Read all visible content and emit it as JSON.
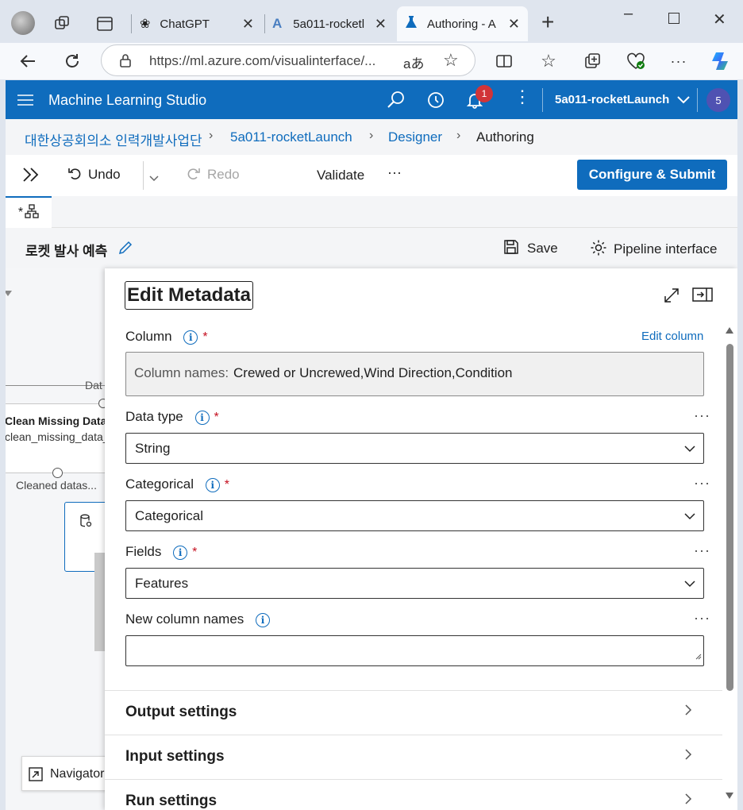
{
  "browser": {
    "tabs": [
      {
        "label": "ChatGPT",
        "close": "✕"
      },
      {
        "label": "5a011-rocketl",
        "close": "✕"
      },
      {
        "label": "Authoring - A",
        "close": "✕"
      }
    ],
    "new_tab": "+",
    "url": "https://ml.azure.com/visualinterface/...",
    "read_aloud": "aあ"
  },
  "header": {
    "app_name": "Machine Learning Studio",
    "notification_count": "1",
    "workspace": "5a011-rocketLaunch",
    "avatar_initial": "5"
  },
  "breadcrumbs": [
    "대한상공회의소 인력개발사업단",
    "5a011-rocketLaunch",
    "Designer",
    "Authoring"
  ],
  "toolbar": {
    "undo": "Undo",
    "redo": "Redo",
    "validate": "Validate",
    "more": "···",
    "submit": "Configure & Submit"
  },
  "tab_label": "*",
  "pipeline": {
    "title": "로켓 발사 예측",
    "save": "Save",
    "interface": "Pipeline interface"
  },
  "canvas": {
    "port_label_top": "Dat",
    "node_title": "Clean Missing Data",
    "node_subtitle": "clean_missing_data_",
    "output_label": "Cleaned datas...",
    "navigator": "Navigator"
  },
  "panel": {
    "title": "Edit Metadata",
    "column_label": "Column",
    "edit_column_link": "Edit column",
    "column_names_prefix": "Column names:",
    "column_names_value": "Crewed or Uncrewed,Wind Direction,Condition",
    "fields": [
      {
        "label": "Data type",
        "value": "String",
        "required": true
      },
      {
        "label": "Categorical",
        "value": "Categorical",
        "required": true
      },
      {
        "label": "Fields",
        "value": "Features",
        "required": true
      }
    ],
    "new_column_names_label": "New column names",
    "new_column_names_value": "",
    "sections": [
      "Output settings",
      "Input settings",
      "Run settings"
    ]
  },
  "colors": {
    "accent": "#0f6cbd",
    "required": "#c50f1f",
    "badge": "#d13438"
  }
}
